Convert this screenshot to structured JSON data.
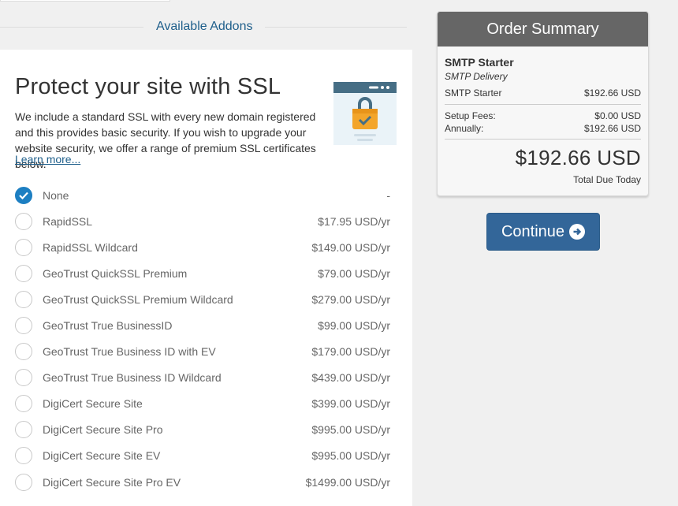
{
  "addons": {
    "title": "Available Addons"
  },
  "ssl": {
    "title": "Protect your site with SSL",
    "description": "We include a standard SSL with every new domain registered and this provides basic security. If you wish to upgrade your website security, we offer a range of premium SSL certificates below.",
    "learn_more": "Learn more...",
    "options": [
      {
        "label": "None",
        "price": "-",
        "checked": true
      },
      {
        "label": "RapidSSL",
        "price": "$17.95 USD/yr"
      },
      {
        "label": "RapidSSL Wildcard",
        "price": "$149.00 USD/yr"
      },
      {
        "label": "GeoTrust QuickSSL Premium",
        "price": "$79.00 USD/yr"
      },
      {
        "label": "GeoTrust QuickSSL Premium Wildcard",
        "price": "$279.00 USD/yr"
      },
      {
        "label": "GeoTrust True BusinessID",
        "price": "$99.00 USD/yr"
      },
      {
        "label": "GeoTrust True Business ID with EV",
        "price": "$179.00 USD/yr"
      },
      {
        "label": "GeoTrust True Business ID Wildcard",
        "price": "$439.00 USD/yr"
      },
      {
        "label": "DigiCert Secure Site",
        "price": "$399.00 USD/yr"
      },
      {
        "label": "DigiCert Secure Site Pro",
        "price": "$995.00 USD/yr"
      },
      {
        "label": "DigiCert Secure Site EV",
        "price": "$995.00 USD/yr"
      },
      {
        "label": "DigiCert Secure Site Pro EV",
        "price": "$1499.00 USD/yr"
      }
    ]
  },
  "summary": {
    "title": "Order Summary",
    "product_name": "SMTP Starter",
    "product_group": "SMTP Delivery",
    "line_label": "SMTP Starter",
    "line_value": "$192.66 USD",
    "setup_label": "Setup Fees:",
    "setup_value": "$0.00 USD",
    "annual_label": "Annually:",
    "annual_value": "$192.66 USD",
    "total": "$192.66 USD",
    "total_label": "Total Due Today"
  },
  "continue": {
    "label": "Continue"
  },
  "colors": {
    "accent": "#336699",
    "checked": "#1d7fc2",
    "header": "#666666"
  }
}
